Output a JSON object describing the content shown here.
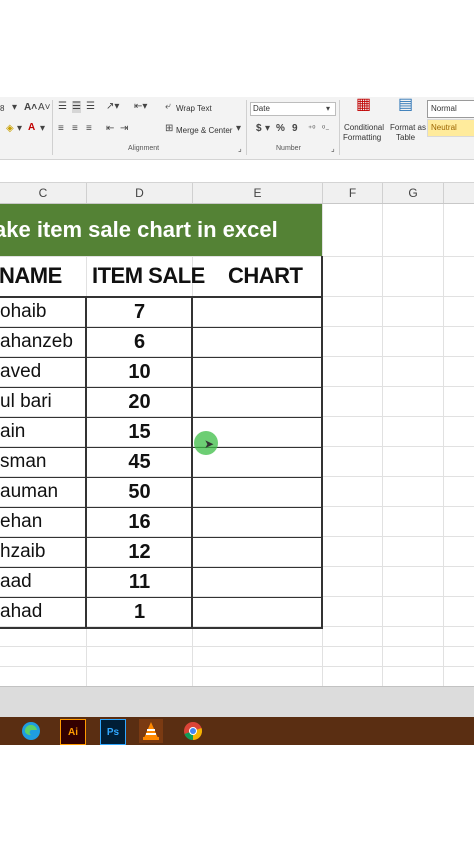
{
  "ribbon": {
    "font_size_label": "8",
    "wrap_text_label": "Wrap Text",
    "merge_center_label": "Merge & Center",
    "number_format_value": "Date",
    "alignment_group_label": "Alignment",
    "number_group_label": "Number",
    "conditional_formatting_label_1": "Conditional",
    "conditional_formatting_label_2": "Formatting",
    "format_as_table_label_1": "Format as",
    "format_as_table_label_2": "Table",
    "style_normal_label": "Normal",
    "style_neutral_label": "Neutral",
    "currency_symbol": "$",
    "percent_symbol": "%",
    "comma_symbol": "9"
  },
  "columns": [
    "C",
    "D",
    "E",
    "F",
    "G"
  ],
  "sheet": {
    "title": "ake item sale chart in excel",
    "headers": {
      "name": "NAME",
      "item_sale": "ITEM SALE",
      "chart": "CHART"
    },
    "rows": [
      {
        "name": "ohaib",
        "value": "7"
      },
      {
        "name": "ahanzeb",
        "value": "6"
      },
      {
        "name": "aved",
        "value": "10"
      },
      {
        "name": "ul bari",
        "value": "20"
      },
      {
        "name": "ain",
        "value": "15"
      },
      {
        "name": "sman",
        "value": "45"
      },
      {
        "name": "auman",
        "value": "50"
      },
      {
        "name": "ehan",
        "value": "16"
      },
      {
        "name": "hzaib",
        "value": "12"
      },
      {
        "name": "aad",
        "value": "11"
      },
      {
        "name": "ahad",
        "value": "1"
      }
    ]
  },
  "taskbar": {
    "icons": [
      "edge-icon",
      "illustrator-icon",
      "photoshop-icon",
      "vlc-icon",
      "chrome-icon"
    ],
    "illustrator_label": "Ai",
    "photoshop_label": "Ps"
  },
  "colors": {
    "title_fill": "#548235",
    "taskbar": "#5a2e12",
    "cursor_highlight": "#3cbe46"
  }
}
